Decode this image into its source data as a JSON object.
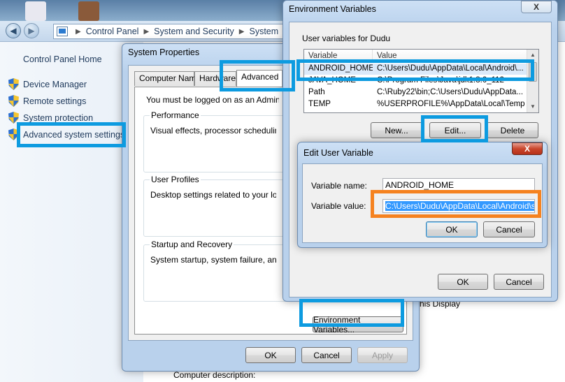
{
  "explorer": {
    "breadcrumbs": [
      "Control Panel",
      "System and Security",
      "System"
    ],
    "left_pane": {
      "home": "Control Panel Home",
      "items": [
        "Device Manager",
        "Remote settings",
        "System protection",
        "Advanced system settings"
      ]
    },
    "bg_fragments": {
      "this_display": "his Display",
      "computer_description": "Computer description:"
    }
  },
  "system_properties": {
    "title": "System Properties",
    "tabs": [
      "Computer Name",
      "Hardware",
      "Advanced"
    ],
    "admin_notice": "You must be logged on as an Administrator to make most of these changes.",
    "groups": [
      {
        "legend": "Performance",
        "text": "Visual effects, processor scheduling, memory usage, and virtual memory"
      },
      {
        "legend": "User Profiles",
        "text": "Desktop settings related to your logon"
      },
      {
        "legend": "Startup and Recovery",
        "text": "System startup, system failure, and debugging information"
      }
    ],
    "env_button": "Environment Variables...",
    "buttons": {
      "ok": "OK",
      "cancel": "Cancel",
      "apply": "Apply"
    }
  },
  "env_vars": {
    "title": "Environment Variables",
    "close": "X",
    "user_group_label": "User variables for Dudu",
    "columns": [
      "Variable",
      "Value"
    ],
    "rows": [
      {
        "name": "ANDROID_HOME",
        "value": "C:\\Users\\Dudu\\AppData\\Local\\Android\\..."
      },
      {
        "name": "JAVA_HOME",
        "value": "C:\\Program Files\\Java\\jdk1.8.0_112"
      },
      {
        "name": "Path",
        "value": "C:\\Ruby22\\bin;C:\\Users\\Dudu\\AppData..."
      },
      {
        "name": "TEMP",
        "value": "%USERPROFILE%\\AppData\\Local\\Temp"
      }
    ],
    "buttons": {
      "new": "New...",
      "edit": "Edit...",
      "delete": "Delete",
      "ok": "OK",
      "cancel": "Cancel"
    }
  },
  "edit_var": {
    "title": "Edit User Variable",
    "close": "X",
    "name_label": "Variable name:",
    "name_value": "ANDROID_HOME",
    "value_label": "Variable value:",
    "value_value": "C:\\Users\\Dudu\\AppData\\Local\\Android\\sdk",
    "buttons": {
      "ok": "OK",
      "cancel": "Cancel"
    }
  },
  "colors": {
    "highlight_blue": "#0d9be0",
    "highlight_orange": "#f58220",
    "selection": "#3399ff"
  }
}
